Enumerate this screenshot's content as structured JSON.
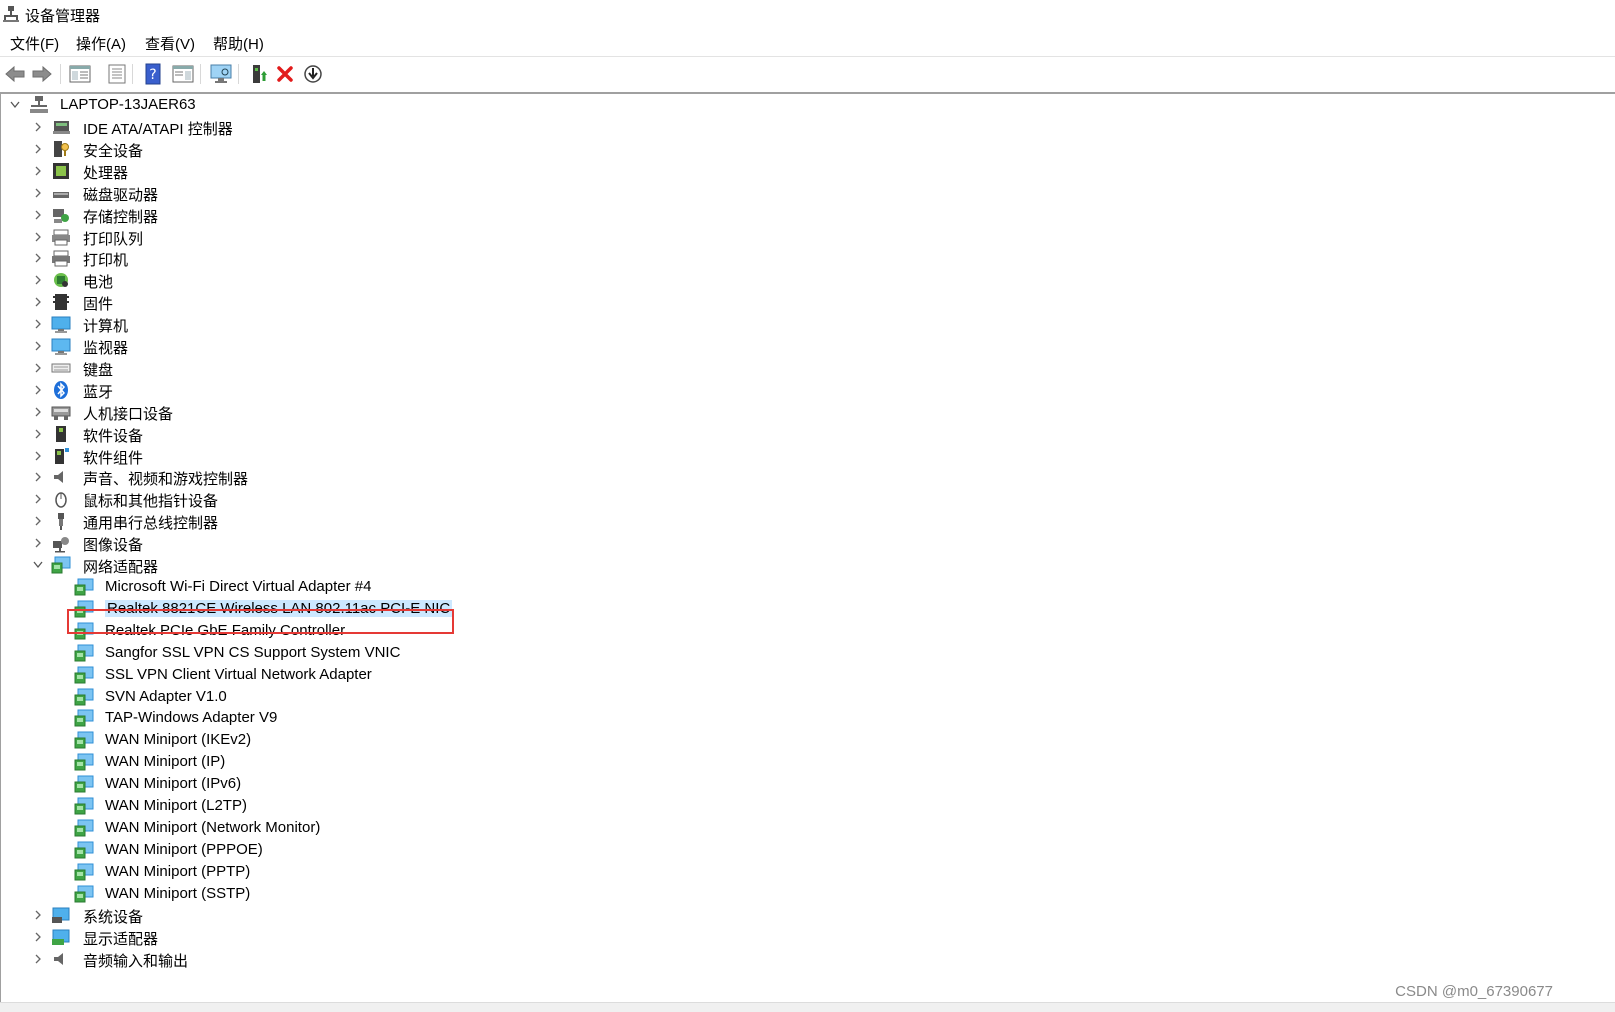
{
  "window": {
    "title": "设备管理器"
  },
  "menu": {
    "file": "文件(F)",
    "action": "操作(A)",
    "view": "查看(V)",
    "help": "帮助(H)"
  },
  "toolbar": {
    "icons": [
      "back-arrow-icon",
      "forward-arrow-icon",
      "show-hide-tree-icon",
      "properties-icon",
      "help-icon",
      "action-pane-icon",
      "scan-hardware-icon",
      "update-driver-icon",
      "uninstall-icon",
      "disable-device-icon"
    ]
  },
  "tree": {
    "root": "LAPTOP-13JAER63",
    "categories_before": [
      {
        "label": "IDE ATA/ATAPI 控制器",
        "icon": "ide-controller-icon"
      },
      {
        "label": "安全设备",
        "icon": "security-device-icon"
      },
      {
        "label": "处理器",
        "icon": "processor-icon"
      },
      {
        "label": "磁盘驱动器",
        "icon": "disk-drive-icon"
      },
      {
        "label": "存储控制器",
        "icon": "storage-controller-icon"
      },
      {
        "label": "打印队列",
        "icon": "print-queue-icon"
      },
      {
        "label": "打印机",
        "icon": "printer-icon"
      },
      {
        "label": "电池",
        "icon": "battery-icon"
      },
      {
        "label": "固件",
        "icon": "firmware-icon"
      },
      {
        "label": "计算机",
        "icon": "computer-icon"
      },
      {
        "label": "监视器",
        "icon": "monitor-icon"
      },
      {
        "label": "键盘",
        "icon": "keyboard-icon"
      },
      {
        "label": "蓝牙",
        "icon": "bluetooth-icon"
      },
      {
        "label": "人机接口设备",
        "icon": "hid-icon"
      },
      {
        "label": "软件设备",
        "icon": "software-device-icon"
      },
      {
        "label": "软件组件",
        "icon": "software-component-icon"
      },
      {
        "label": "声音、视频和游戏控制器",
        "icon": "sound-icon"
      },
      {
        "label": "鼠标和其他指针设备",
        "icon": "mouse-icon"
      },
      {
        "label": "通用串行总线控制器",
        "icon": "usb-icon"
      },
      {
        "label": "图像设备",
        "icon": "camera-icon"
      }
    ],
    "network_category": "网络适配器",
    "network_adapters": [
      "Microsoft Wi-Fi Direct Virtual Adapter #4",
      "Realtek 8821CE Wireless LAN 802.11ac PCI-E NIC",
      "Realtek PCIe GbE Family Controller",
      "Sangfor SSL VPN CS Support System VNIC",
      "SSL VPN Client Virtual Network Adapter",
      "SVN Adapter V1.0",
      "TAP-Windows Adapter V9",
      "WAN Miniport (IKEv2)",
      "WAN Miniport (IP)",
      "WAN Miniport (IPv6)",
      "WAN Miniport (L2TP)",
      "WAN Miniport (Network Monitor)",
      "WAN Miniport (PPPOE)",
      "WAN Miniport (PPTP)",
      "WAN Miniport (SSTP)"
    ],
    "selected_adapter": "Realtek 8821CE Wireless LAN 802.11ac PCI-E NIC",
    "categories_after": [
      {
        "label": "系统设备",
        "icon": "system-device-icon"
      },
      {
        "label": "显示适配器",
        "icon": "display-adapter-icon"
      },
      {
        "label": "音频输入和输出",
        "icon": "audio-io-icon"
      }
    ]
  },
  "watermark": "CSDN @m0_67390677",
  "colors": {
    "selection": "#cce8ff",
    "highlight_box": "#e53935",
    "network_icon": "#2f8fd6"
  }
}
